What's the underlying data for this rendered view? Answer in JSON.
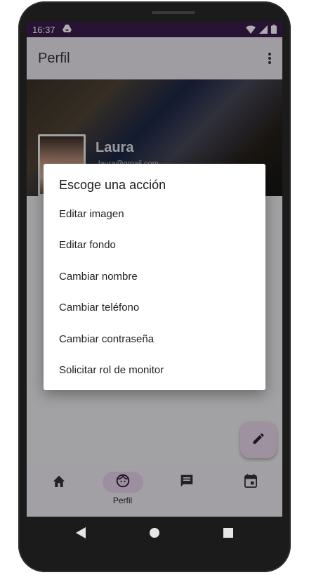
{
  "status_bar": {
    "time": "16:37",
    "drive_icon": "drive-icon",
    "wifi_icon": "wifi-icon",
    "signal_icon": "signal-icon",
    "battery_icon": "battery-icon"
  },
  "app_bar": {
    "title": "Perfil",
    "menu_icon": "more-vert-icon"
  },
  "profile": {
    "name": "Laura",
    "email": "laura@gmail.com"
  },
  "dialog": {
    "title": "Escoge una acción",
    "options": [
      "Editar imagen",
      "Editar fondo",
      "Cambiar nombre",
      "Cambiar teléfono",
      "Cambiar contraseña",
      "Solicitar rol de monitor"
    ]
  },
  "fab": {
    "icon": "edit-icon"
  },
  "bottom_nav": {
    "items": [
      {
        "icon": "home-icon",
        "label": ""
      },
      {
        "icon": "face-icon",
        "label": "Perfil"
      },
      {
        "icon": "chat-icon",
        "label": ""
      },
      {
        "icon": "calendar-icon",
        "label": ""
      }
    ]
  },
  "system_nav": {
    "back_icon": "back-icon",
    "home_icon": "home-circle-icon",
    "recents_icon": "recents-icon"
  },
  "colors": {
    "status_bar": "#3b1d4f",
    "accent_container": "#ead7ec",
    "scrim": "rgba(0,0,0,0.32)"
  }
}
